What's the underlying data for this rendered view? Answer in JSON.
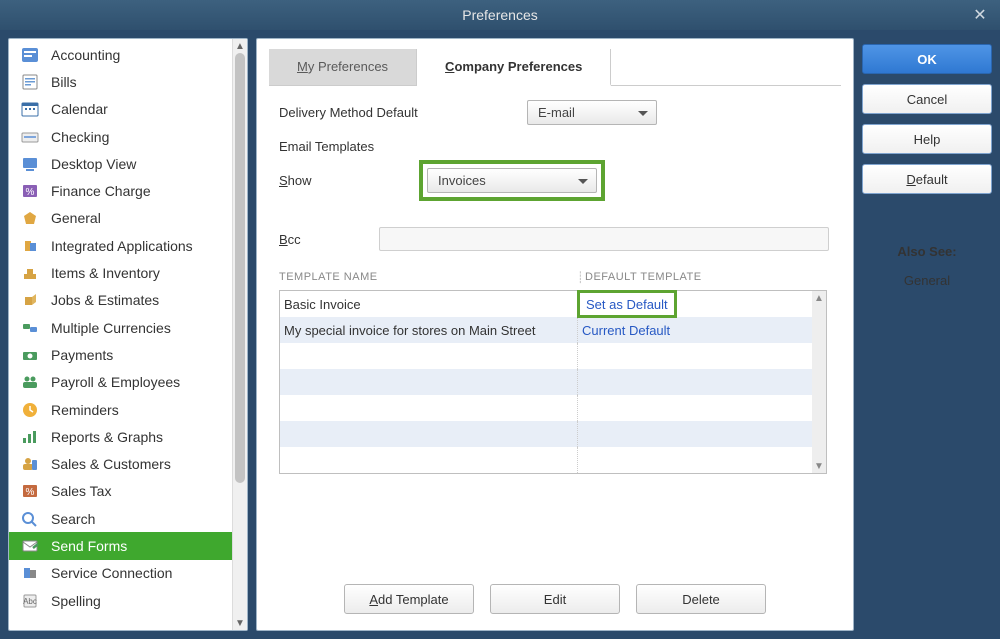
{
  "title": "Preferences",
  "sidebar": {
    "items": [
      {
        "label": "Accounting"
      },
      {
        "label": "Bills"
      },
      {
        "label": "Calendar"
      },
      {
        "label": "Checking"
      },
      {
        "label": "Desktop View"
      },
      {
        "label": "Finance Charge"
      },
      {
        "label": "General"
      },
      {
        "label": "Integrated Applications"
      },
      {
        "label": "Items & Inventory"
      },
      {
        "label": "Jobs & Estimates"
      },
      {
        "label": "Multiple Currencies"
      },
      {
        "label": "Payments"
      },
      {
        "label": "Payroll & Employees"
      },
      {
        "label": "Reminders"
      },
      {
        "label": "Reports & Graphs"
      },
      {
        "label": "Sales & Customers"
      },
      {
        "label": "Sales Tax"
      },
      {
        "label": "Search"
      },
      {
        "label": "Send Forms"
      },
      {
        "label": "Service Connection"
      },
      {
        "label": "Spelling"
      }
    ],
    "selected_index": 18
  },
  "tabs": {
    "my_prefix": "M",
    "my_rest": "y Preferences",
    "company_prefix": "C",
    "company_rest": "ompany Preferences"
  },
  "form": {
    "delivery_label": "Delivery Method Default",
    "delivery_value": "E-mail",
    "email_templates_label": "Email Templates",
    "show_prefix": "S",
    "show_rest": "how",
    "show_value": "Invoices",
    "bcc_prefix": "B",
    "bcc_rest": "cc",
    "bcc_value": ""
  },
  "table": {
    "header_name": "TEMPLATE NAME",
    "header_default": "DEFAULT TEMPLATE",
    "rows": [
      {
        "name": "Basic Invoice",
        "default": "Set as Default"
      },
      {
        "name": "My special invoice for stores on Main Street",
        "default": "Current Default"
      },
      {
        "name": "",
        "default": ""
      },
      {
        "name": "",
        "default": ""
      },
      {
        "name": "",
        "default": ""
      },
      {
        "name": "",
        "default": ""
      },
      {
        "name": "",
        "default": ""
      }
    ],
    "highlight_row": 0
  },
  "actions": {
    "add_prefix": "A",
    "add_rest": "dd Template",
    "edit": "Edit",
    "delete": "Delete"
  },
  "right": {
    "ok": "OK",
    "cancel": "Cancel",
    "help": "Help",
    "default_prefix": "D",
    "default_rest": "efault",
    "also_see": "Also See:",
    "general": "General"
  }
}
